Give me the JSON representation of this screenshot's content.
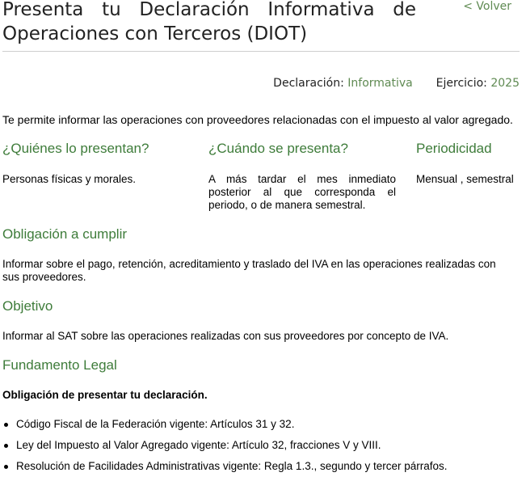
{
  "header": {
    "title": "Presenta tu Declaración Informativa de Operaciones con Terceros (DIOT)",
    "back_label": "< Volver"
  },
  "meta": {
    "declaracion_label": "Declaración:",
    "declaracion_value": "Informativa",
    "ejercicio_label": "Ejercicio:",
    "ejercicio_value": "2025"
  },
  "description": "Te permite informar las operaciones con proveedores relacionadas con el impuesto al valor agregado.",
  "columns": [
    {
      "heading": "¿Quiénes lo presentan?",
      "text": "Personas físicas y morales."
    },
    {
      "heading": "¿Cuándo se presenta?",
      "text": "A más tardar el mes inmediato posterior al que corresponda el periodo, o de manera semestral."
    },
    {
      "heading": "Periodicidad",
      "text": "Mensual , semestral"
    }
  ],
  "obligacion": {
    "heading": "Obligación a cumplir",
    "text": "Informar sobre el pago, retención, acreditamiento y traslado del IVA en las operaciones realizadas con sus proveedores."
  },
  "objetivo": {
    "heading": "Objetivo",
    "text": "Informar al SAT sobre las operaciones realizadas con sus proveedores por concepto de IVA."
  },
  "fundamento": {
    "heading": "Fundamento Legal",
    "subheading": "Obligación de presentar tu declaración.",
    "items": [
      "Código Fiscal de la Federación vigente: Artículos 31 y 32.",
      "Ley del Impuesto al Valor Agregado vigente: Artículo 32, fracciones V y VIII.",
      "Resolución de Facilidades Administrativas vigente: Regla 1.3., segundo y tercer párrafos."
    ]
  },
  "colors": {
    "accent_green": "#3e7c3a",
    "link_green": "#5f8a52",
    "divider": "#cfcfcf"
  }
}
